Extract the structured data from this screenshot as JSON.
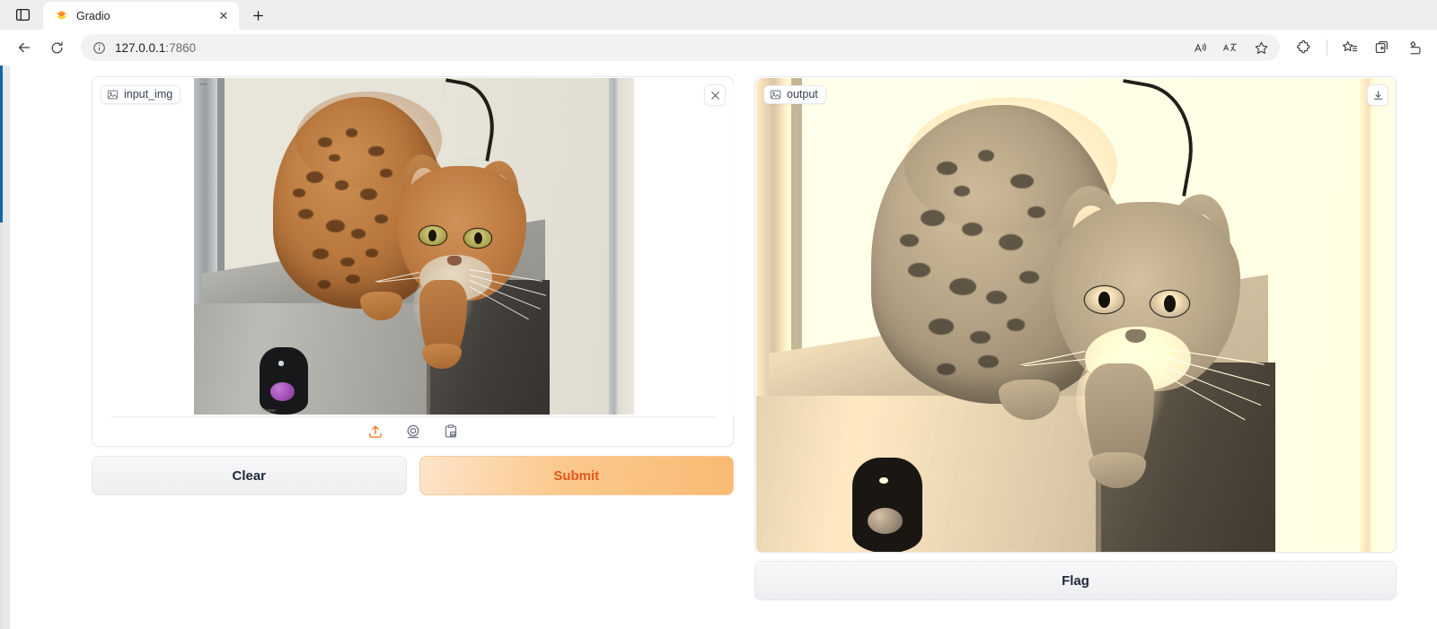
{
  "browser": {
    "tab_overview_icon": "tab-overview-icon",
    "tab": {
      "favicon": "gradio-favicon",
      "title": "Gradio",
      "close_label": "✕"
    },
    "new_tab_label": "+",
    "nav": {
      "back_icon": "back-arrow-icon",
      "reload_icon": "reload-icon",
      "info_icon": "site-info-icon",
      "url_host": "127.0.0.1",
      "url_port": ":7860",
      "read_aloud_icon": "read-aloud-icon",
      "translate_icon": "translate-icon",
      "favorite_icon": "add-favorite-star-icon",
      "extensions_icon": "extensions-puzzle-icon",
      "favorites_icon": "favorites-list-icon",
      "collections_icon": "collections-icon",
      "split_screen_icon": "split-screen-icon"
    }
  },
  "app": {
    "input_block": {
      "label": "input_img",
      "label_icon": "image-icon",
      "clear_icon": "close-x-icon",
      "tools": [
        {
          "name": "upload-icon",
          "title": "Upload"
        },
        {
          "name": "webcam-icon",
          "title": "Webcam"
        },
        {
          "name": "paste-clipboard-icon",
          "title": "Paste from clipboard"
        }
      ]
    },
    "output_block": {
      "label": "output",
      "label_icon": "image-icon",
      "download_icon": "download-icon"
    },
    "buttons": {
      "clear": "Clear",
      "submit": "Submit",
      "flag": "Flag"
    },
    "colors": {
      "primary_text": "#e2571d",
      "primary_gradient_start": "#fde4cb",
      "primary_gradient_end": "#f9ba72",
      "secondary_bg": "#eceef0",
      "panel_border": "#e5e7eb",
      "accent_rail": "#1565a6"
    },
    "photo": {
      "subject": "bengal-kitten-on-computer-tower",
      "tower_label": "Power",
      "watermark": "flickr"
    }
  }
}
